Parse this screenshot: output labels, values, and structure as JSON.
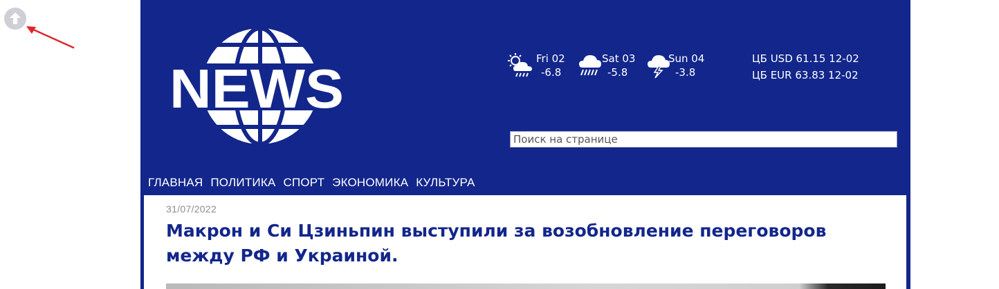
{
  "weather": [
    {
      "day": "Fri 02",
      "temp": "-6.8",
      "icon": "sun-cloud-rain-icon"
    },
    {
      "day": "Sat 03",
      "temp": "-5.8",
      "icon": "cloud-rain-icon"
    },
    {
      "day": "Sun 04",
      "temp": "-3.8",
      "icon": "cloud-thunder-icon"
    }
  ],
  "rates": {
    "usd": "ЦБ USD 61.15 12-02",
    "eur": "ЦБ EUR 63.83 12-02"
  },
  "search": {
    "placeholder": "Поиск на странице"
  },
  "nav": [
    "ГЛАВНАЯ",
    "ПОЛИТИКА",
    "СПОРТ",
    "ЭКОНОМИКА",
    "КУЛЬТУРА"
  ],
  "logo": {
    "text": "NEWS"
  },
  "article": {
    "date": "31/07/2022",
    "title": "Макрон и Си Цзиньпин выступили за возобновление переговоров между РФ и Украиной."
  },
  "colors": {
    "brand": "#13268b",
    "annotation": "#e0262b",
    "date": "#8c8c8c"
  }
}
